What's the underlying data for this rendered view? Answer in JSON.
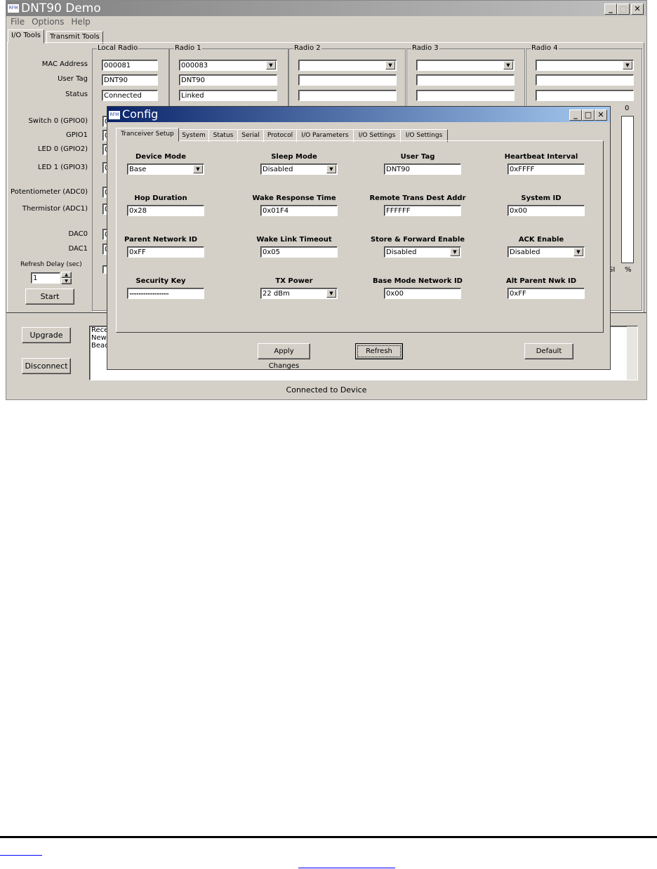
{
  "app": {
    "title": "DNT90 Demo",
    "logo_text": "RFM",
    "menu": [
      "File",
      "Options",
      "Help"
    ],
    "tabs": [
      "I/O Tools",
      "Transmit Tools"
    ]
  },
  "radios": [
    {
      "name": "Local Radio",
      "mac": "000081",
      "tag": "DNT90",
      "status": "Connected",
      "has_dropdown": false
    },
    {
      "name": "Radio 1",
      "mac": "000083",
      "tag": "DNT90",
      "status": "Linked",
      "has_dropdown": true
    },
    {
      "name": "Radio 2",
      "mac": "",
      "tag": "",
      "status": "",
      "has_dropdown": true
    },
    {
      "name": "Radio 3",
      "mac": "",
      "tag": "",
      "status": "",
      "has_dropdown": true
    },
    {
      "name": "Radio 4",
      "mac": "",
      "tag": "",
      "status": "",
      "has_dropdown": true
    }
  ],
  "row_labels": {
    "mac": "MAC Address",
    "tag": "User Tag",
    "status": "Status"
  },
  "io_labels": [
    "Switch 0 (GPIO0)",
    "GPIO1",
    "LED 0 (GPIO2)",
    "LED 1 (GPIO3)",
    "Potentiometer (ADC0)",
    "Thermistor (ADC1)",
    "DAC0",
    "DAC1"
  ],
  "refresh": {
    "label": "Refresh Delay (sec)",
    "value": "1",
    "start": "Start"
  },
  "rssi": {
    "value": "0",
    "unit": "%",
    "label": "SI",
    "level_percent": 0
  },
  "bottom": {
    "upgrade": "Upgrade",
    "disconnect": "Disconnect",
    "log": [
      "Rece",
      "New",
      "Beac"
    ],
    "status": "Connected to Device"
  },
  "config": {
    "title": "Config",
    "logo_text": "RFM",
    "tabs": [
      "Tranceiver Setup",
      "System",
      "Status",
      "Serial",
      "Protocol",
      "I/O Parameters",
      "I/O Settings",
      "I/O Settings"
    ],
    "fields": [
      {
        "label": "Device Mode",
        "value": "Base",
        "type": "select"
      },
      {
        "label": "Sleep Mode",
        "value": "Disabled",
        "type": "select"
      },
      {
        "label": "User Tag",
        "value": "DNT90",
        "type": "text"
      },
      {
        "label": "Heartbeat Interval",
        "value": "0xFFFF",
        "type": "text"
      },
      {
        "label": "Hop Duration",
        "value": "0x28",
        "type": "text"
      },
      {
        "label": "Wake Response Time",
        "value": "0x01F4",
        "type": "text"
      },
      {
        "label": "Remote Trans Dest Addr",
        "value": "FFFFFF",
        "type": "text"
      },
      {
        "label": "System ID",
        "value": "0x00",
        "type": "text"
      },
      {
        "label": "Parent Network ID",
        "value": "0xFF",
        "type": "text"
      },
      {
        "label": "Wake Link Timeout",
        "value": "0x05",
        "type": "text"
      },
      {
        "label": "Store & Forward Enable",
        "value": "Disabled",
        "type": "select"
      },
      {
        "label": "ACK Enable",
        "value": "Disabled",
        "type": "select"
      },
      {
        "label": "Security Key",
        "value": "••••••••••••••••••••••",
        "type": "password"
      },
      {
        "label": "TX Power",
        "value": "22 dBm",
        "type": "select"
      },
      {
        "label": "Base Mode Network ID",
        "value": "0x00",
        "type": "text"
      },
      {
        "label": "Alt Parent Nwk ID",
        "value": "0xFF",
        "type": "text"
      }
    ],
    "buttons": {
      "apply": "Apply Changes",
      "refresh": "Refresh",
      "default": "Default"
    }
  },
  "colors": {
    "window": "#d4d0c8",
    "active_title": "#0a246a",
    "link": "#0000ff"
  }
}
